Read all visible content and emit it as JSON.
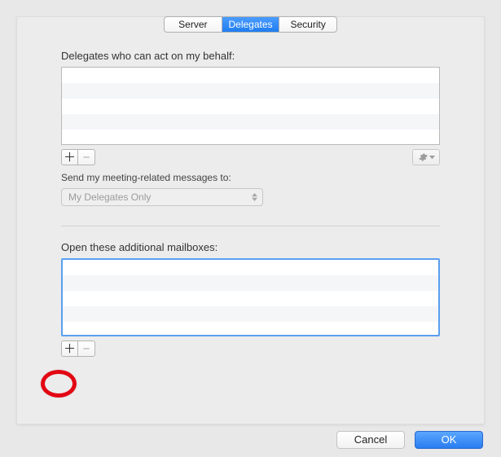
{
  "tabs": {
    "server": "Server",
    "delegates": "Delegates",
    "security": "Security",
    "selected": "delegates"
  },
  "delegates": {
    "label": "Delegates who can act on my behalf:",
    "items": [],
    "send_label": "Send my meeting-related messages to:",
    "send_select_value": "My Delegates Only"
  },
  "mailboxes": {
    "label": "Open these additional mailboxes:",
    "items": []
  },
  "buttons": {
    "plus": "＋",
    "minus": "−",
    "cancel": "Cancel",
    "ok": "OK"
  },
  "icons": {
    "gear": "gear-icon",
    "chevron": "chevron-down-icon"
  }
}
